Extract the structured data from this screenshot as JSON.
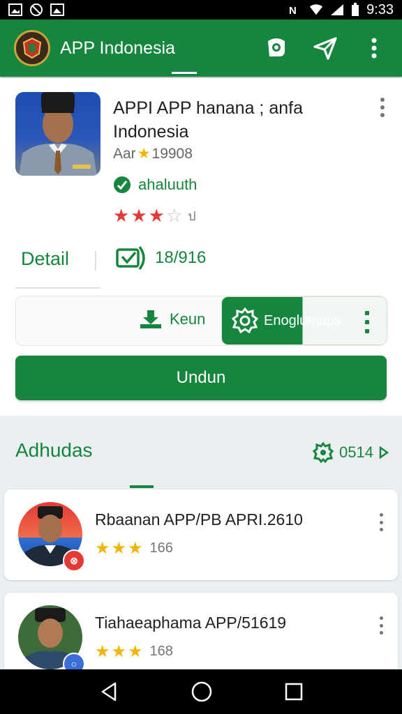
{
  "status_bar": {
    "time": "9:33"
  },
  "app_bar": {
    "title": "APP Indonesia"
  },
  "app": {
    "name": "APPI APP hanana ; anfa Indonesia",
    "meta_prefix": "Aar",
    "meta_value": "19908",
    "verified_label": "ahaluuth",
    "rating_stars": 3,
    "rating_max": 5,
    "rating_suffix": "ป"
  },
  "tabs": {
    "detail_label": "Detail",
    "version_label": "18/916"
  },
  "actions": {
    "keun_label": "Keun",
    "language_label": "Enoglumaps",
    "download_label": "Undun"
  },
  "section": {
    "title": "Adhudas",
    "action_label": "0514"
  },
  "list": [
    {
      "title": "Rbaanan APP/PB APRI.2610",
      "stars": 3,
      "count": "166"
    },
    {
      "title": "Tiahaeaphama  APP/51619",
      "stars": 3,
      "count": "168"
    }
  ],
  "colors": {
    "primary": "#16853d",
    "star_red": "#e53935",
    "star_gold": "#f4b400"
  }
}
